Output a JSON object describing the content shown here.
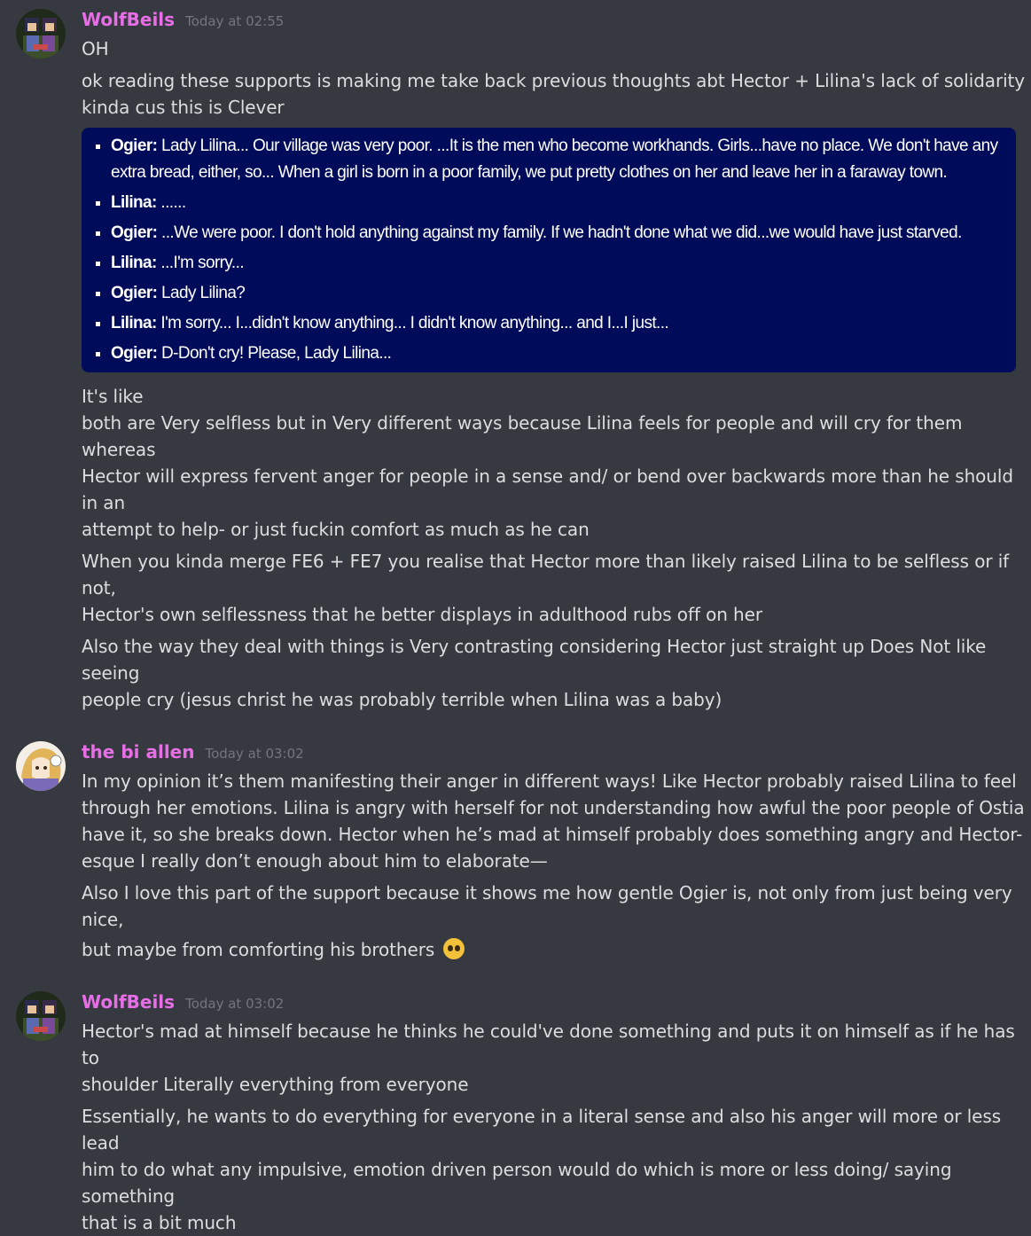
{
  "colors": {
    "background": "#36393f",
    "username_wolf": "#e86ee8",
    "username_allen": "#e86ee8",
    "timestamp": "#72767d",
    "quote_bg": "#000b5a"
  },
  "messages": [
    {
      "username": "WolfBeils",
      "timestamp": "Today at 02:55",
      "avatar_icon": "pixel-character-avatar",
      "lines": [
        "OH",
        "ok reading these supports is making me take back previous thoughts abt Hector + Lilina's lack of  solidarity",
        "kinda cus this is Clever"
      ],
      "quote": [
        {
          "speaker": "Ogier:",
          "text": " Lady Lilina... Our village was very poor. ...It is the men who become workhands. Girls...have no place. We don't have any extra bread, either, so... When a girl is born in a poor family, we put pretty clothes on her and leave her in a faraway town."
        },
        {
          "speaker": "Lilina:",
          "text": " ......"
        },
        {
          "speaker": "Ogier:",
          "text": " ...We were poor. I don't hold anything against my family. If we hadn't done what we did...we would have just starved."
        },
        {
          "speaker": "Lilina:",
          "text": " ...I'm sorry..."
        },
        {
          "speaker": "Ogier:",
          "text": " Lady Lilina?"
        },
        {
          "speaker": "Lilina:",
          "text": " I'm sorry... I...didn't know anything... I didn't know anything... and I...I just..."
        },
        {
          "speaker": "Ogier:",
          "text": " D-Don't cry! Please, Lady Lilina..."
        }
      ],
      "after_quote": [
        "It's like",
        "both are Very selfless but in Very different ways because Lilina feels for people and will cry for them whereas",
        "Hector will express fervent anger for people in a sense and/ or bend over backwards more than he should in an",
        "attempt to help- or just fuckin comfort as much as he can"
      ],
      "para2": [
        "When you kinda merge FE6 + FE7 you realise that Hector more than likely raised Lilina to be selfless or if not,",
        "Hector's own selflessness that he better displays in adulthood rubs off on her"
      ],
      "para3": [
        "Also the way they deal with things is Very contrasting considering Hector just straight up Does Not like seeing",
        "people cry (jesus christ he was probably terrible when Lilina was  a baby)"
      ]
    },
    {
      "username": "the bi allen",
      "timestamp": "Today at 03:02",
      "avatar_icon": "drawn-character-avatar",
      "para1": [
        "In my opinion it’s them manifesting their anger in different ways! Like Hector probably raised Lilina to feel",
        "through her emotions. Lilina is angry with herself for not understanding how awful the poor people of Ostia",
        "have it, so she breaks down. Hector when he’s mad at himself probably does something angry and Hector-",
        "esque I really don’t enough about him to elaborate—"
      ],
      "para2_line1": "Also I love this part of the support because it shows me how gentle Ogier is, not only from just being very nice,",
      "para2_line2": "but maybe from comforting his brothers",
      "emoji_icon": "pleading-face-icon"
    },
    {
      "username": "WolfBeils",
      "timestamp": "Today at 03:02",
      "avatar_icon": "pixel-character-avatar",
      "para1": [
        "Hector's mad at himself because he thinks he could've done something and puts it on himself as if he has to",
        "shoulder Literally everything from everyone"
      ],
      "para2": [
        "Essentially, he wants to do everything for everyone in a literal sense and also his anger will more or less lead",
        "him to do what any impulsive, emotion driven person would do which is more or less doing/ saying something",
        "that is a bit much"
      ]
    }
  ]
}
